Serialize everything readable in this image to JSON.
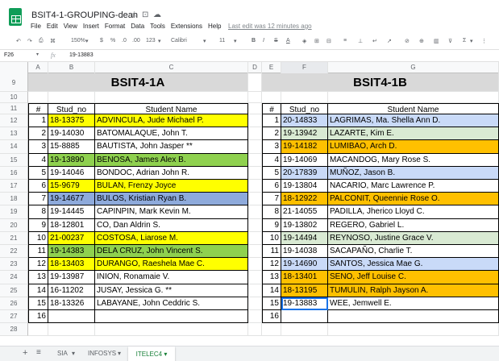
{
  "app": {
    "title": "BSIT4-1-GROUPING-dean",
    "last_edit": "Last edit was 12 minutes ago",
    "menu": [
      "File",
      "Edit",
      "View",
      "Insert",
      "Format",
      "Data",
      "Tools",
      "Extensions",
      "Help"
    ]
  },
  "toolbar": {
    "zoom": "150%",
    "currency": "$",
    "percent": "%",
    "decimal_less": ".0",
    "decimal_more": ".00",
    "more_formats": "123",
    "font": "Calibri",
    "font_size": "11",
    "bold": "B",
    "italic": "I",
    "strike": "S",
    "text_color": "A"
  },
  "formula_bar": {
    "cell_ref": "F26",
    "fx": "fx",
    "value": "19-13883"
  },
  "columns": [
    "A",
    "B",
    "C",
    "D",
    "E",
    "F",
    "G"
  ],
  "left_table": {
    "title": "BSIT4-1A",
    "headers": [
      "#",
      "Stud_no",
      "Student Name"
    ],
    "rows": [
      {
        "n": "1",
        "id": "18-13375",
        "name": "ADVINCULA, Jude Michael P.",
        "color": "yellow"
      },
      {
        "n": "2",
        "id": "19-14030",
        "name": "BATOMALAQUE, John T.",
        "color": ""
      },
      {
        "n": "3",
        "id": "15-8885",
        "name": "BAUTISTA, John Jasper **",
        "color": ""
      },
      {
        "n": "4",
        "id": "19-13890",
        "name": "BENOSA, James Alex B.",
        "color": "green"
      },
      {
        "n": "5",
        "id": "19-14046",
        "name": "BONDOC, Adrian John R.",
        "color": ""
      },
      {
        "n": "6",
        "id": "15-9679",
        "name": "BULAN, Frenzy Joyce",
        "color": "yellow"
      },
      {
        "n": "7",
        "id": "19-14677",
        "name": "BULOS, Kristian Ryan B.",
        "color": "blue"
      },
      {
        "n": "8",
        "id": "19-14445",
        "name": "CAPINPIN, Mark Kevin M.",
        "color": ""
      },
      {
        "n": "9",
        "id": "18-12801",
        "name": "CO, Dan Aldrin S.",
        "color": ""
      },
      {
        "n": "10",
        "id": "21-00237",
        "name": "COSTOSA, Liarose M.",
        "color": "yellow"
      },
      {
        "n": "11",
        "id": "19-14383",
        "name": "DELA CRUZ, John Vincent S.",
        "color": "green"
      },
      {
        "n": "12",
        "id": "18-13403",
        "name": "DURANGO, Raeshela Mae C.",
        "color": "yellow"
      },
      {
        "n": "13",
        "id": "19-13987",
        "name": "INION, Ronamaie V.",
        "color": ""
      },
      {
        "n": "14",
        "id": "16-11202",
        "name": "JUSAY, Jessica G. **",
        "color": ""
      },
      {
        "n": "15",
        "id": "18-13326",
        "name": "LABAYANE, John Ceddric S.",
        "color": ""
      },
      {
        "n": "16",
        "id": "",
        "name": "",
        "color": ""
      },
      {
        "n": "",
        "id": "",
        "name": "",
        "color": ""
      }
    ]
  },
  "right_table": {
    "title": "BSIT4-1B",
    "headers": [
      "#",
      "Stud_no",
      "Student Name"
    ],
    "rows": [
      {
        "n": "1",
        "id": "20-14833",
        "name": "LAGRIMAS, Ma. Shella Ann D.",
        "color": "lightblue"
      },
      {
        "n": "2",
        "id": "19-13942",
        "name": "LAZARTE, Kim E.",
        "color": "lightgreen"
      },
      {
        "n": "3",
        "id": "19-14182",
        "name": "LUMIBAO, Arch D.",
        "color": "orange"
      },
      {
        "n": "4",
        "id": "19-14069",
        "name": "MACANDOG, Mary Rose S.",
        "color": ""
      },
      {
        "n": "5",
        "id": "20-17839",
        "name": "MUÑOZ, Jason B.",
        "color": "lightblue"
      },
      {
        "n": "6",
        "id": "19-13804",
        "name": "NACARIO, Marc Lawrence P.",
        "color": ""
      },
      {
        "n": "7",
        "id": "18-12922",
        "name": "PALCONIT, Queennie Rose O.",
        "color": "orange"
      },
      {
        "n": "8",
        "id": "21-14055",
        "name": "PADILLA, Jherico Lloyd C.",
        "color": ""
      },
      {
        "n": "9",
        "id": "19-13802",
        "name": "REGERO, Gabriel L.",
        "color": ""
      },
      {
        "n": "10",
        "id": "19-14494",
        "name": "REYNOSO, Justine Grace V.",
        "color": "lightgreen"
      },
      {
        "n": "11",
        "id": "19-14038",
        "name": "SACAPAÑO, Charlie T.",
        "color": ""
      },
      {
        "n": "12",
        "id": "19-14690",
        "name": "SANTOS, Jessica Mae G.",
        "color": "lightblue"
      },
      {
        "n": "13",
        "id": "18-13401",
        "name": "SENO, Jeff Louise C.",
        "color": "orange"
      },
      {
        "n": "14",
        "id": "18-13195",
        "name": "TUMULIN, Ralph Jayson A.",
        "color": "orange"
      },
      {
        "n": "15",
        "id": "19-13883",
        "name": "WEE, Jemwell E.",
        "color": ""
      },
      {
        "n": "16",
        "id": "",
        "name": "",
        "color": ""
      },
      {
        "n": "",
        "id": "",
        "name": "",
        "color": ""
      }
    ]
  },
  "row_numbers": [
    "9",
    "10",
    "11",
    "12",
    "13",
    "14",
    "15",
    "16",
    "17",
    "18",
    "19",
    "20",
    "21",
    "22",
    "23",
    "24",
    "25",
    "26",
    "27",
    "28"
  ],
  "sheet_tabs": [
    {
      "label": "SIA",
      "active": false
    },
    {
      "label": "INFOSYS",
      "active": false
    },
    {
      "label": "ITELEC4",
      "active": true
    }
  ],
  "colors": {
    "yellow": "#ffff00",
    "green": "#8fd14f",
    "blue": "#8eaadb",
    "lightblue": "#c9daf8",
    "orange": "#ffc000",
    "lightgreen": "#d9ead3",
    "header_gray": "#d9d9d9",
    "active_tab": "#188038"
  }
}
